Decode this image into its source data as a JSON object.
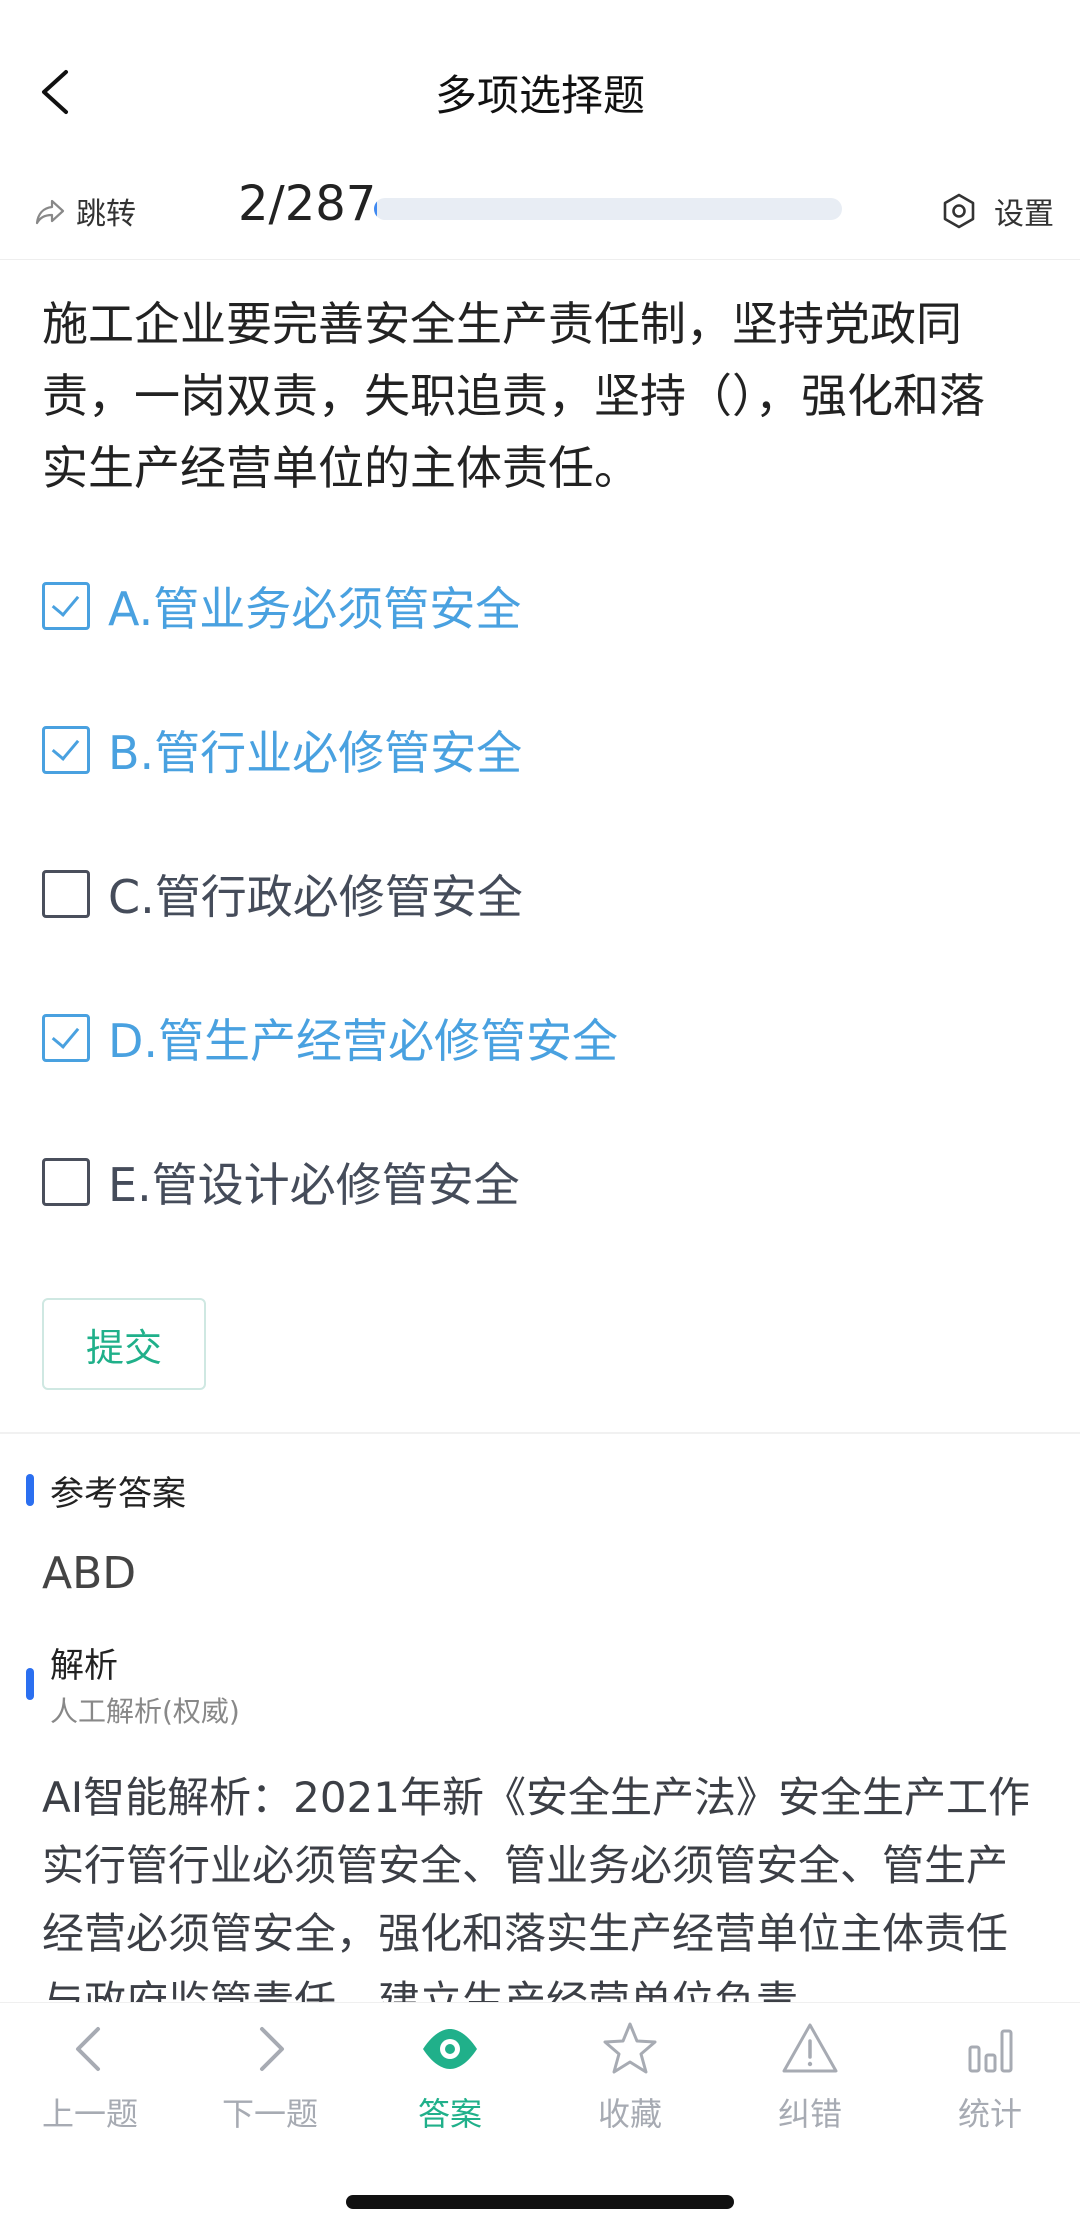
{
  "header": {
    "title": "多项选择题"
  },
  "toolbar": {
    "jump_label": "跳转",
    "progress_text": "2/287",
    "progress_fraction": 0.007,
    "settings_label": "设置"
  },
  "question": {
    "text": "施工企业要完善安全生产责任制，坚持党政同责，一岗双责，失职追责，坚持（），强化和落实生产经营单位的主体责任。",
    "options": [
      {
        "label": "A.管业务必须管安全",
        "checked": true
      },
      {
        "label": "B.管行业必修管安全",
        "checked": true
      },
      {
        "label": "C.管行政必修管安全",
        "checked": false
      },
      {
        "label": "D.管生产经营必修管安全",
        "checked": true
      },
      {
        "label": "E.管设计必修管安全",
        "checked": false
      }
    ],
    "submit_label": "提交"
  },
  "answer": {
    "title": "参考答案",
    "value": "ABD"
  },
  "analysis": {
    "title": "解析",
    "subtitle": "人工解析(权威)",
    "text": "AI智能解析：2021年新《安全生产法》安全生产工作实行管行业必须管安全、管业务必须管安全、管生产经营必须管安全，强化和落实生产经营单位主体责任与政府监管责任，建立生产经营单位负责"
  },
  "bottom_nav": {
    "items": [
      {
        "label": "上一题",
        "icon": "chevron-left-icon",
        "active": false
      },
      {
        "label": "下一题",
        "icon": "chevron-right-icon",
        "active": false
      },
      {
        "label": "答案",
        "icon": "eye-icon",
        "active": true
      },
      {
        "label": "收藏",
        "icon": "star-icon",
        "active": false
      },
      {
        "label": "纠错",
        "icon": "warning-icon",
        "active": false
      },
      {
        "label": "统计",
        "icon": "bar-chart-icon",
        "active": false
      }
    ]
  },
  "colors": {
    "accent_blue": "#49a1e0",
    "active_green": "#20b08a",
    "marker_blue": "#2b6ff0"
  }
}
